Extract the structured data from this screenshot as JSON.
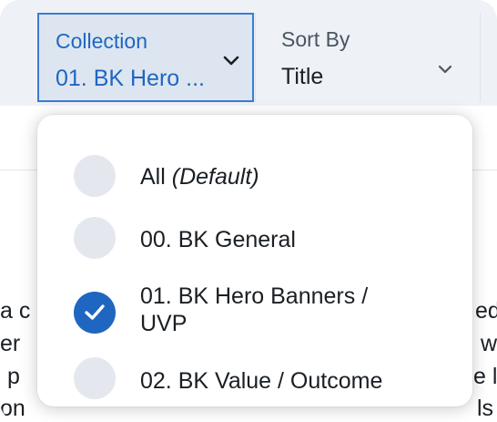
{
  "filters": {
    "collection": {
      "label": "Collection",
      "value": "01. BK Hero ..."
    },
    "sort": {
      "label": "Sort By",
      "value": "Title"
    }
  },
  "background_fragments": {
    "left": [
      "a c",
      "er",
      "p",
      "on"
    ],
    "right": [
      "ed",
      "w",
      "e l",
      "ls"
    ]
  },
  "menu": {
    "items": [
      {
        "label": "All",
        "suffix": "(Default)",
        "selected": false
      },
      {
        "label": "00. BK General",
        "selected": false
      },
      {
        "label_line1": "01. BK Hero Banners /",
        "label_line2": "UVP",
        "selected": true
      },
      {
        "label": "02. BK Value / Outcome",
        "selected": false
      }
    ]
  },
  "colors": {
    "accent": "#1f66c1",
    "toolbar_bg": "#eef2f6",
    "radio_unselected": "#e4e8ee"
  },
  "icons": {
    "filter_chevron": "chevron-down-icon",
    "selected_mark": "checkmark-icon"
  }
}
